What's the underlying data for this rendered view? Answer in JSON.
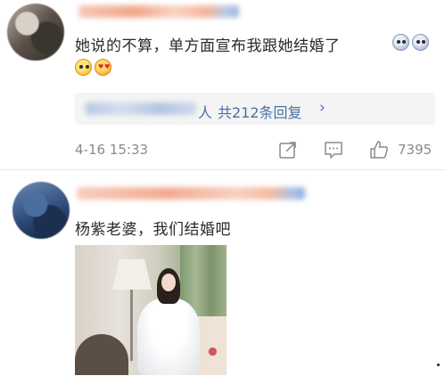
{
  "comments": [
    {
      "text": "她说的不算，单方面宣布我跟她结婚了",
      "reply_summary": {
        "suffix_person": "人",
        "count_label": "共212条回复",
        "chevron": "›"
      },
      "timestamp": "4-16 15:33",
      "like_count": "7395",
      "emojis": [
        "shocked-face",
        "shocked-face",
        "smirk-face",
        "heart-eyes-face"
      ]
    },
    {
      "text": "杨紫老婆，我们结婚吧",
      "has_photo": true
    }
  ],
  "icons": {
    "share": "share-icon",
    "comment": "comment-icon",
    "like": "thumbs-up-icon"
  },
  "colors": {
    "link": "#4a6fa8",
    "meta": "#8a8a8a",
    "reply_bg": "#f4f4f4"
  }
}
